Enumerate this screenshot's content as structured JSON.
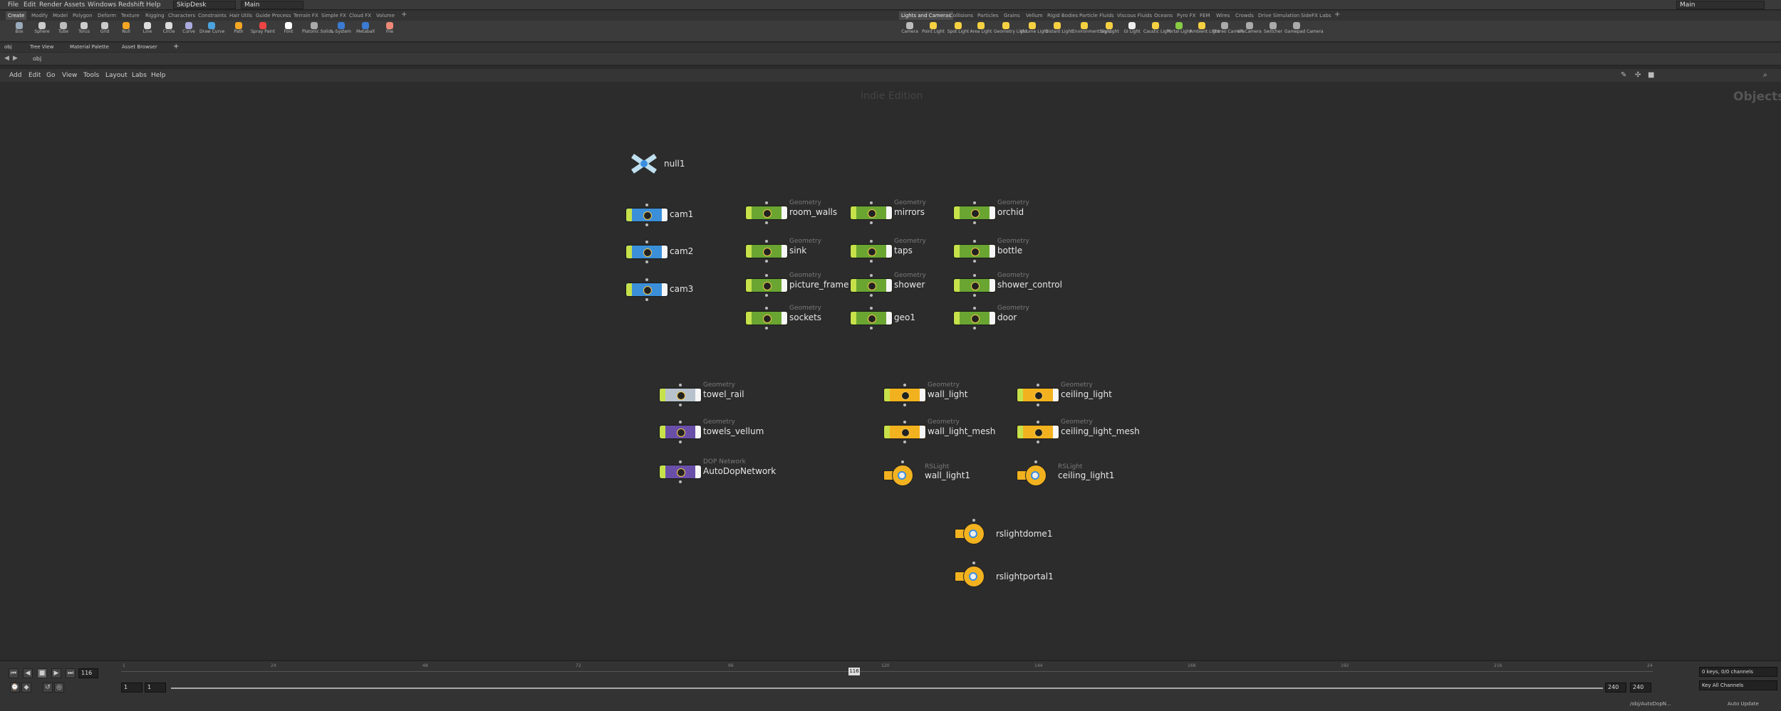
{
  "menubar": {
    "items": [
      "File",
      "Edit",
      "Render",
      "Assets",
      "Windows",
      "Redshift",
      "Help"
    ],
    "desktop": "SkipDesk",
    "context": "Main",
    "right_context": "Main"
  },
  "shelf_left": {
    "tabs": [
      "Create",
      "Modify",
      "Model",
      "Polygon",
      "Deform",
      "Texture",
      "Rigging",
      "Characters",
      "Constraints",
      "Hair Utils",
      "Guide Process",
      "Terrain FX",
      "Simple FX",
      "Cloud FX",
      "Volume",
      "+"
    ],
    "tools": [
      "Box",
      "Sphere",
      "Tube",
      "Torus",
      "Grid",
      "Null",
      "Line",
      "Circle",
      "Curve",
      "Draw Curve",
      "Path",
      "Spray Paint",
      "Font",
      "Platonic Solids",
      "L-System",
      "Metaball",
      "File"
    ]
  },
  "shelf_right": {
    "tabs": [
      "Lights and Cameras",
      "Collisions",
      "Particles",
      "Grains",
      "Vellum",
      "Rigid Bodies",
      "Particle Fluids",
      "Viscous Fluids",
      "Oceans",
      "Pyro FX",
      "FEM",
      "Wires",
      "Crowds",
      "Drive Simulation",
      "SideFX Labs",
      "+"
    ],
    "tools": [
      "Camera",
      "Point Light",
      "Spot Light",
      "Area Light",
      "Geometry Light",
      "Volume Light",
      "Distant Light",
      "Environment Light",
      "Sky Light",
      "GI Light",
      "Caustic Light",
      "Portal Light",
      "Ambient Light",
      "Stereo Camera",
      "VR Camera",
      "Switcher",
      "Gamepad Camera"
    ]
  },
  "pane_tabs": [
    "obj",
    "Tree View",
    "Material Palette",
    "Asset Browser",
    "+"
  ],
  "path": "obj",
  "net_menu": [
    "Add",
    "Edit",
    "Go",
    "View",
    "Tools",
    "Layout",
    "Labs",
    "Help"
  ],
  "network": {
    "watermark": "Indie Edition",
    "context_label": "Objects",
    "nodes": [
      {
        "name": "null1",
        "type": ""
      },
      {
        "name": "cam1",
        "type": ""
      },
      {
        "name": "cam2",
        "type": ""
      },
      {
        "name": "cam3",
        "type": ""
      },
      {
        "name": "room_walls",
        "type": "Geometry"
      },
      {
        "name": "sink",
        "type": "Geometry"
      },
      {
        "name": "picture_frame",
        "type": "Geometry"
      },
      {
        "name": "sockets",
        "type": "Geometry"
      },
      {
        "name": "mirrors",
        "type": "Geometry"
      },
      {
        "name": "taps",
        "type": "Geometry"
      },
      {
        "name": "shower",
        "type": "Geometry"
      },
      {
        "name": "geo1",
        "type": ""
      },
      {
        "name": "orchid",
        "type": "Geometry"
      },
      {
        "name": "bottle",
        "type": "Geometry"
      },
      {
        "name": "shower_control",
        "type": "Geometry"
      },
      {
        "name": "door",
        "type": "Geometry"
      },
      {
        "name": "towel_rail",
        "type": "Geometry"
      },
      {
        "name": "towels_vellum",
        "type": "Geometry"
      },
      {
        "name": "AutoDopNetwork",
        "type": "DOP Network"
      },
      {
        "name": "wall_light",
        "type": "Geometry"
      },
      {
        "name": "wall_light_mesh",
        "type": "Geometry"
      },
      {
        "name": "wall_light1",
        "type": "RSLight"
      },
      {
        "name": "ceiling_light",
        "type": "Geometry"
      },
      {
        "name": "ceiling_light_mesh",
        "type": "Geometry"
      },
      {
        "name": "ceiling_light1",
        "type": "RSLight"
      },
      {
        "name": "rslightdome1",
        "type": ""
      },
      {
        "name": "rslightportal1",
        "type": ""
      }
    ]
  },
  "playbar": {
    "current_frame": "116",
    "frame_marker": "116",
    "ticks": [
      "1",
      "24",
      "48",
      "72",
      "96",
      "120",
      "144",
      "168",
      "192",
      "216",
      "24"
    ],
    "range_start": "1",
    "range_start2": "1",
    "range_end": "240",
    "range_end2": "240",
    "keys_info": "0 keys, 0/0 channels",
    "key_all": "Key All Channels",
    "status_path": "/obj/AutoDopN...",
    "auto_update": "Auto Update"
  }
}
